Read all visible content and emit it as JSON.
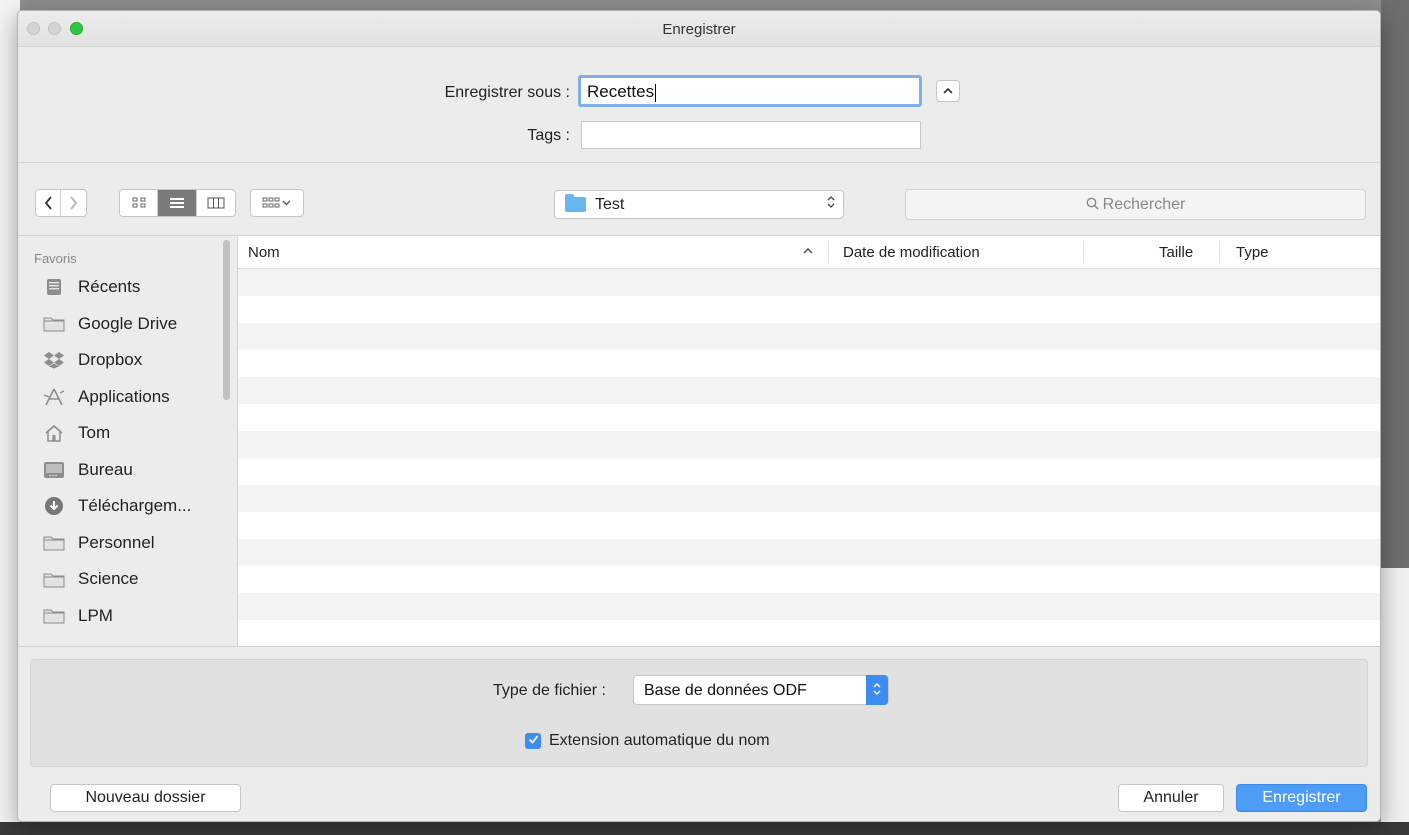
{
  "window": {
    "title": "Enregistrer"
  },
  "name_field": {
    "label": "Enregistrer sous :",
    "value": "Recettes"
  },
  "tags_field": {
    "label": "Tags :",
    "value": ""
  },
  "toolbar": {
    "back_glyph": "‹",
    "forward_glyph": "›",
    "current_folder": "Test",
    "search_placeholder": "Rechercher"
  },
  "sidebar": {
    "section_title": "Favoris",
    "items": [
      {
        "label": "Récents",
        "icon": "recents-icon"
      },
      {
        "label": "Google Drive",
        "icon": "folder-icon"
      },
      {
        "label": "Dropbox",
        "icon": "dropbox-icon"
      },
      {
        "label": "Applications",
        "icon": "applications-icon"
      },
      {
        "label": "Tom",
        "icon": "home-icon"
      },
      {
        "label": "Bureau",
        "icon": "desktop-icon"
      },
      {
        "label": "Téléchargem...",
        "icon": "downloads-icon"
      },
      {
        "label": "Personnel",
        "icon": "folder-icon"
      },
      {
        "label": "Science",
        "icon": "folder-icon"
      },
      {
        "label": "LPM",
        "icon": "folder-icon"
      }
    ]
  },
  "file_list": {
    "columns": {
      "name": "Nom",
      "date": "Date de modification",
      "size": "Taille",
      "type": "Type"
    },
    "sort_indicator": "^",
    "rows": []
  },
  "options": {
    "file_type_label": "Type de fichier :",
    "file_type_value": "Base de données ODF",
    "auto_extension_label": "Extension automatique du nom",
    "auto_extension_checked": true
  },
  "buttons": {
    "new_folder": "Nouveau dossier",
    "cancel": "Annuler",
    "save": "Enregistrer"
  },
  "colors": {
    "accent": "#4d9df6",
    "focus_ring": "#7fb0ea",
    "folder": "#69b6ee",
    "traffic_zoom": "#2ec840"
  }
}
